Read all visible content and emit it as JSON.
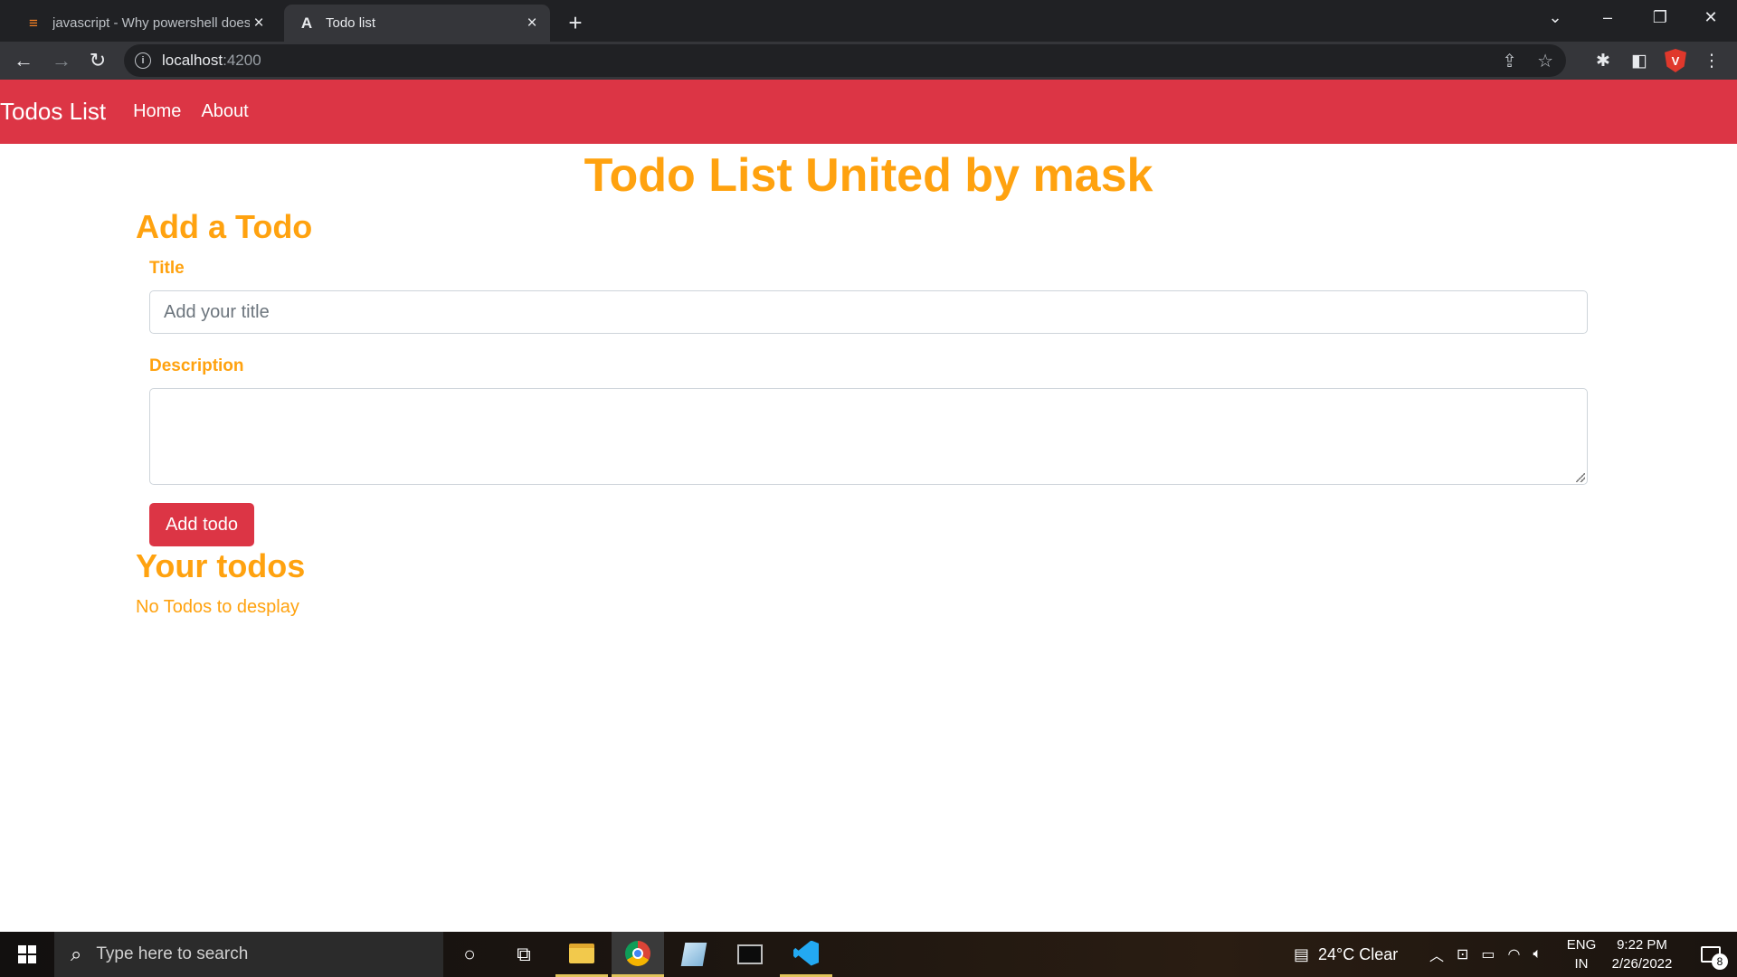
{
  "browser": {
    "tabs": [
      {
        "title": "javascript - Why powershell does not",
        "icon": "stackoverflow-icon",
        "active": false
      },
      {
        "title": "Todo list",
        "icon": "angular-icon",
        "active": true
      }
    ],
    "url_host": "localhost",
    "url_port": ":4200"
  },
  "navbar": {
    "brand": "Todos List",
    "links": [
      "Home",
      "About"
    ],
    "color": "#dc3545"
  },
  "page": {
    "title": "Todo List United by mask",
    "add_heading": "Add a Todo",
    "title_label": "Title",
    "title_placeholder": "Add your title",
    "description_label": "Description",
    "description_value": "",
    "add_button": "Add todo",
    "todos_heading": "Your todos",
    "empty_message": "No Todos to desplay",
    "accent_color": "#ffa20f"
  },
  "taskbar": {
    "search_placeholder": "Type here to search",
    "weather": "24°C  Clear",
    "lang_line1": "ENG",
    "lang_line2": "IN",
    "time": "9:22 PM",
    "date": "2/26/2022",
    "notification_count": "8"
  }
}
